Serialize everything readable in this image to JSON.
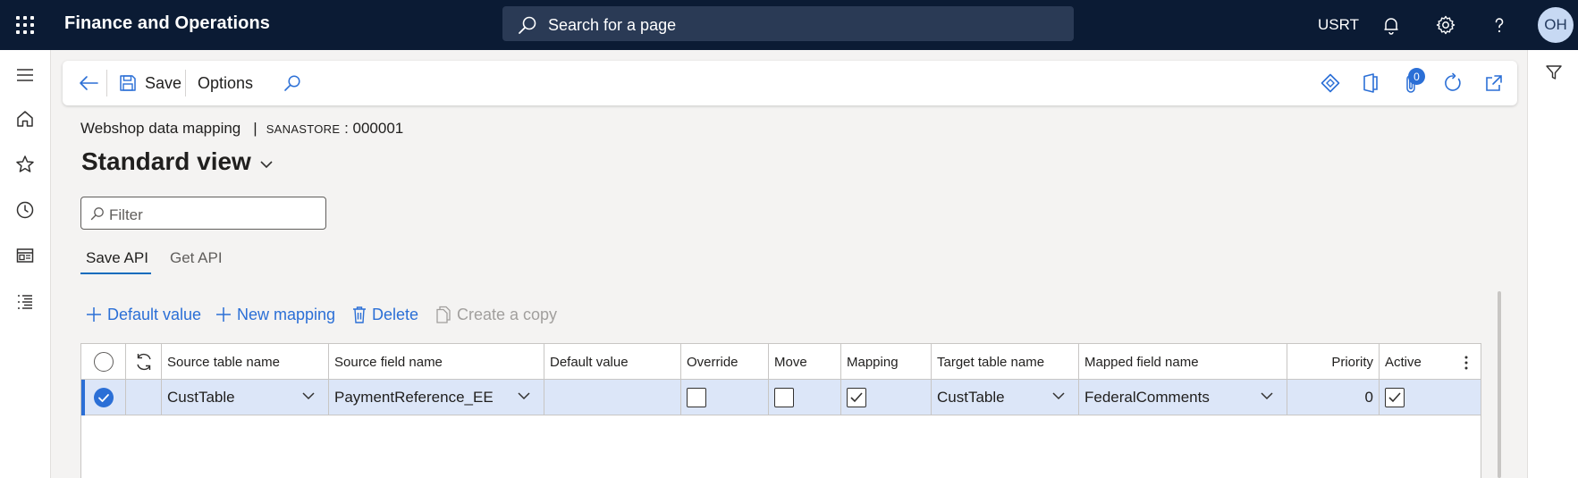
{
  "topbar": {
    "app_title": "Finance and Operations",
    "search_label": "Search for a page",
    "company": "USRT",
    "avatar_initials": "OH"
  },
  "actionbar": {
    "save_label": "Save",
    "options_label": "Options",
    "attachments_count": "0"
  },
  "breadcrumb": {
    "page": "Webshop data mapping",
    "record_prefix": "SANASTORE",
    "record_suffix": " : 000001"
  },
  "view": {
    "title": "Standard view"
  },
  "filter": {
    "placeholder": "Filter"
  },
  "tabs": [
    {
      "label": "Save API",
      "active": true
    },
    {
      "label": "Get API",
      "active": false
    }
  ],
  "commands": {
    "default_value": "Default value",
    "new_mapping": "New mapping",
    "delete": "Delete",
    "create_copy": "Create a copy"
  },
  "grid": {
    "columns": {
      "source_table": "Source table name",
      "source_field": "Source field name",
      "default_value": "Default value",
      "override": "Override",
      "move": "Move",
      "mapping": "Mapping",
      "target_table": "Target table name",
      "mapped_field": "Mapped field name",
      "priority": "Priority",
      "active": "Active"
    },
    "rows": [
      {
        "source_table": "CustTable",
        "source_field": "PaymentReference_EE",
        "default_value": "",
        "override": false,
        "move": false,
        "mapping": true,
        "target_table": "CustTable",
        "mapped_field": "FederalComments",
        "priority": "0",
        "active": true,
        "selected": true
      }
    ]
  },
  "colors": {
    "topbar": "#0b1b34",
    "accent": "#2b6fd6",
    "selected_row": "#dce6f8"
  }
}
